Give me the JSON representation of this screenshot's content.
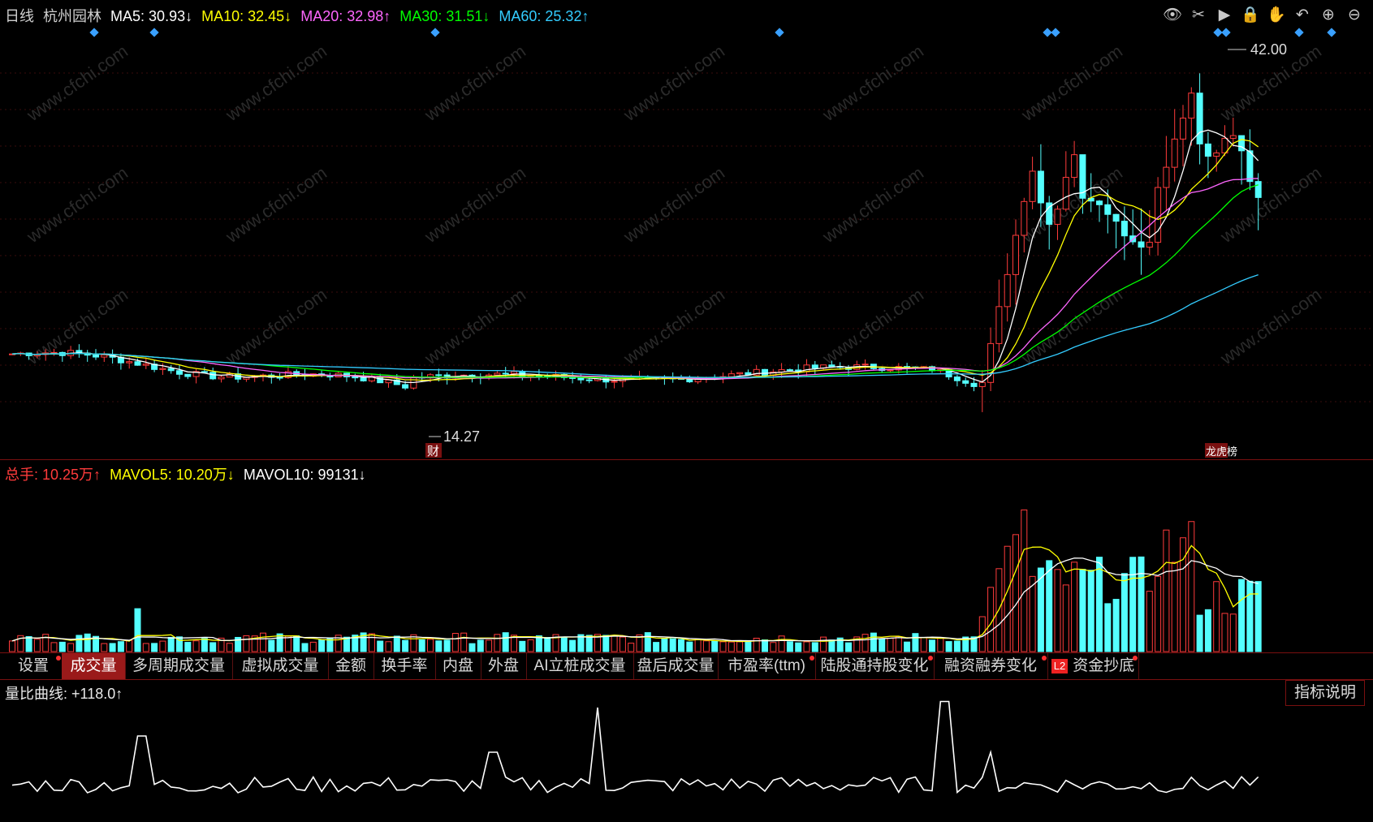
{
  "legend_price": {
    "period": "日线",
    "stock": "杭州园林",
    "ma5": "MA5: 30.93↓",
    "ma10": "MA10: 32.45↓",
    "ma20": "MA20: 32.98↑",
    "ma30": "MA30: 31.51↓",
    "ma60": "MA60: 25.32↑"
  },
  "legend_volume": {
    "total": "总手: 10.25万↑",
    "mavol5": "MAVOL5: 10.20万↓",
    "mavol10": "MAVOL10: 99131↓"
  },
  "legend_ratio": {
    "label": "量比曲线: +118.0↑"
  },
  "price_annotations": {
    "high_label": "42.00",
    "low_label": "14.27",
    "event_tag_fin": "财",
    "event_tag_list": "龙虎榜"
  },
  "toolbar": [
    "eye-icon",
    "scissors-icon",
    "play-icon",
    "lock-icon",
    "hand-icon",
    "undo-icon",
    "zoom-in-icon",
    "zoom-out-icon"
  ],
  "tabs": [
    {
      "label": "设置",
      "dot": true
    },
    {
      "label": "成交量",
      "active": true
    },
    {
      "label": "多周期成交量"
    },
    {
      "label": "虚拟成交量"
    },
    {
      "label": "金额"
    },
    {
      "label": "换手率"
    },
    {
      "label": "内盘"
    },
    {
      "label": "外盘"
    },
    {
      "label": "AI立桩成交量"
    },
    {
      "label": "盘后成交量"
    },
    {
      "label": "市盈率(ttm)",
      "dot": true
    },
    {
      "label": "陆股通持股变化",
      "dot": true
    },
    {
      "label": "融资融券变化",
      "dot": true
    },
    {
      "label": "资金抄底",
      "dot": true,
      "badge": "L2"
    }
  ],
  "indicator_button": "指标说明",
  "watermark": "www.cfchi.com",
  "colors": {
    "up": "#ff3b3b",
    "down": "#54ffff",
    "ma5": "#ffffff",
    "ma10": "#ffff00",
    "ma20": "#ff66ff",
    "ma30": "#00ff00",
    "ma60": "#33ccff"
  },
  "chart_data": {
    "type": "candlestick",
    "price_extremes": {
      "high": 42.0,
      "low": 14.27
    },
    "moving_averages": {
      "MA5": 30.93,
      "MA10": 32.45,
      "MA20": 32.98,
      "MA30": 31.51,
      "MA60": 25.32
    },
    "volume": {
      "last": "10.25万",
      "MAVOL5": "10.20万",
      "MAVOL10": 99131
    },
    "volume_ratio_last": 118.0
  }
}
